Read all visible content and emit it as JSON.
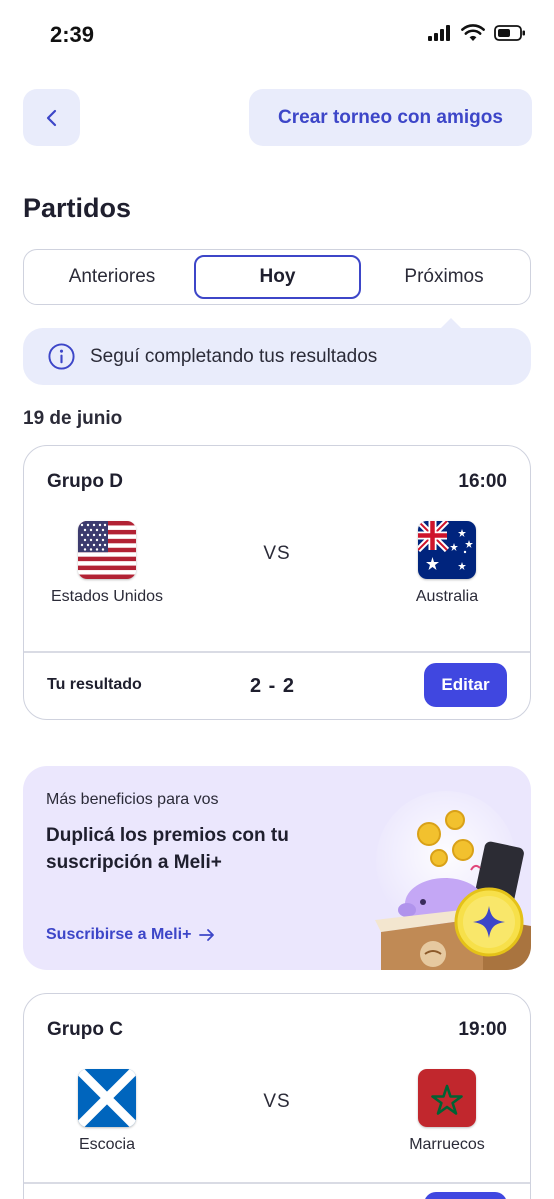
{
  "status_bar": {
    "time": "2:39"
  },
  "header": {
    "create_label": "Crear torneo con amigos"
  },
  "page": {
    "title": "Partidos"
  },
  "tabs": [
    {
      "label": "Anteriores",
      "selected": false
    },
    {
      "label": "Hoy",
      "selected": true
    },
    {
      "label": "Próximos",
      "selected": false
    }
  ],
  "info_banner": {
    "text": "Seguí completando tus resultados",
    "icon": "info-icon"
  },
  "date_label": "19 de junio",
  "matches": [
    {
      "group": "Grupo D",
      "time": "16:00",
      "home": {
        "name": "Estados Unidos",
        "flag": "usa-flag"
      },
      "away": {
        "name": "Australia",
        "flag": "australia-flag"
      },
      "vs": "VS",
      "result_label": "Tu resultado",
      "score": "2 - 2",
      "edit_label": "Editar"
    },
    {
      "group": "Grupo C",
      "time": "19:00",
      "home": {
        "name": "Escocia",
        "flag": "scotland-flag"
      },
      "away": {
        "name": "Marruecos",
        "flag": "morocco-flag"
      },
      "vs": "VS"
    }
  ],
  "promo": {
    "subtitle": "Más beneficios para vos",
    "title": "Duplicá los premios con tu suscripción a Meli+",
    "link": "Suscribirse a Meli+"
  },
  "colors": {
    "accent": "#3d46c8",
    "button": "#4047e0",
    "soft_bg": "#e9ecfb",
    "promo_bg": "#ebe7fd"
  }
}
